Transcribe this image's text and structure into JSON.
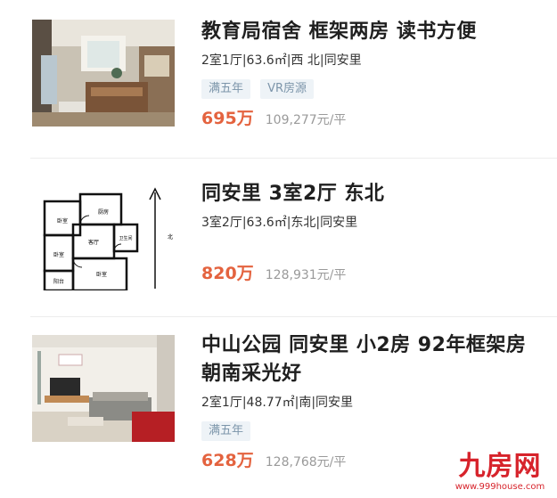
{
  "listings": [
    {
      "title": "教育局宿舍 框架两房 读书方便",
      "attributes": "2室1厅|63.6㎡|西 北|同安里",
      "tags": [
        "满五年",
        "VR房源"
      ],
      "price": "695万",
      "unit_price": "109,277元/平"
    },
    {
      "title": "同安里 3室2厅 东北",
      "attributes": "3室2厅|63.6㎡|东北|同安里",
      "tags": [],
      "price": "820万",
      "unit_price": "128,931元/平",
      "floorplan": {
        "rooms": [
          "卧室",
          "厨房",
          "客厅",
          "卫生间",
          "卧室",
          "卧室",
          "阳台"
        ],
        "compass": "北"
      }
    },
    {
      "title": "中山公园 同安里 小2房 92年框架房 朝南采光好",
      "attributes": "2室1厅|48.77㎡|南|同安里",
      "tags": [
        "满五年"
      ],
      "price": "628万",
      "unit_price": "128,768元/平"
    }
  ],
  "watermark": {
    "logo": "九房网",
    "url": "www.999house.com"
  },
  "colors": {
    "price": "#e4633f",
    "tag_bg": "#eef3f7",
    "tag_text": "#7c95aa",
    "watermark": "#d7232b"
  }
}
